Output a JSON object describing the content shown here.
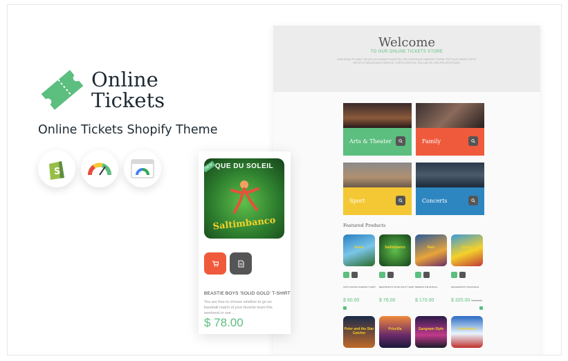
{
  "brand": {
    "name_line1": "Online",
    "name_line2": "Tickets",
    "theme_title": "Online Tickets Shopify Theme"
  },
  "badges": [
    {
      "icon": "shopify-icon"
    },
    {
      "icon": "speedometer-icon"
    },
    {
      "icon": "browser-speed-icon"
    }
  ],
  "colors": {
    "accent": "#5cbe7f",
    "red": "#f05a3c",
    "yellow": "#f4c834",
    "blue": "#2e86c1",
    "dark": "#555555"
  },
  "mobile": {
    "badge": "NEW",
    "poster_title": "QUE DU SOLEIL",
    "poster_logo": "Saltimbanco",
    "cart_icon": "cart-icon",
    "details_icon": "document-icon",
    "product_name": "BEASTIE BOYS 'SOLID GOLD' T-SHIRT",
    "description": "You are free to choose whether to go an baseball match of your favorite team this weekend or see ...",
    "price": "$ 78.00"
  },
  "desktop": {
    "welcome_title": "Welcome",
    "welcome_subtitle": "TO OUR ONLINE TICKETS STORE",
    "welcome_text": "MAECENAS SIT AMET NEQUE ACCUMSAN PHARETRA. PELLENTESQUE HABITANT MORBI TRISTIQUE SENECTUS ET NETUS ET MALESUADA FAMES AC TURPIS EGESTAS. NULLAM VEL SEM PELLENTESQUE.",
    "categories": [
      {
        "label": "Arts & Theater",
        "color": "#5cbe7f"
      },
      {
        "label": "Family",
        "color": "#f05a3c"
      },
      {
        "label": "Sport",
        "color": "#f4c834"
      },
      {
        "label": "Concerts",
        "color": "#2e86c1"
      }
    ],
    "featured_title": "Featured Products",
    "products_row1": [
      {
        "title": "Annie",
        "name": "SOUTH PACIFIC DIAMOND T-SHIRT",
        "price": "$ 60.00",
        "old": ""
      },
      {
        "title": "Saltimbanco",
        "name": "BEASTIE BOYS 'SOLID GOLD' T-SHIRT",
        "price": "$ 76.00",
        "old": ""
      },
      {
        "title": "Rain",
        "name": "MEMPHIS THE MUSICAL",
        "price": "$ 170.00",
        "old": ""
      },
      {
        "title": "Disney",
        "name": "DESCENDANTS THE MUSICAL",
        "price": "$ 320.00",
        "old": "$ 340.00"
      }
    ],
    "products_row2": [
      {
        "title": "Peter and the Star Catcher"
      },
      {
        "title": "Priscilla"
      },
      {
        "title": "Gangnam Style"
      },
      {
        "title": "Scandalous"
      }
    ]
  }
}
